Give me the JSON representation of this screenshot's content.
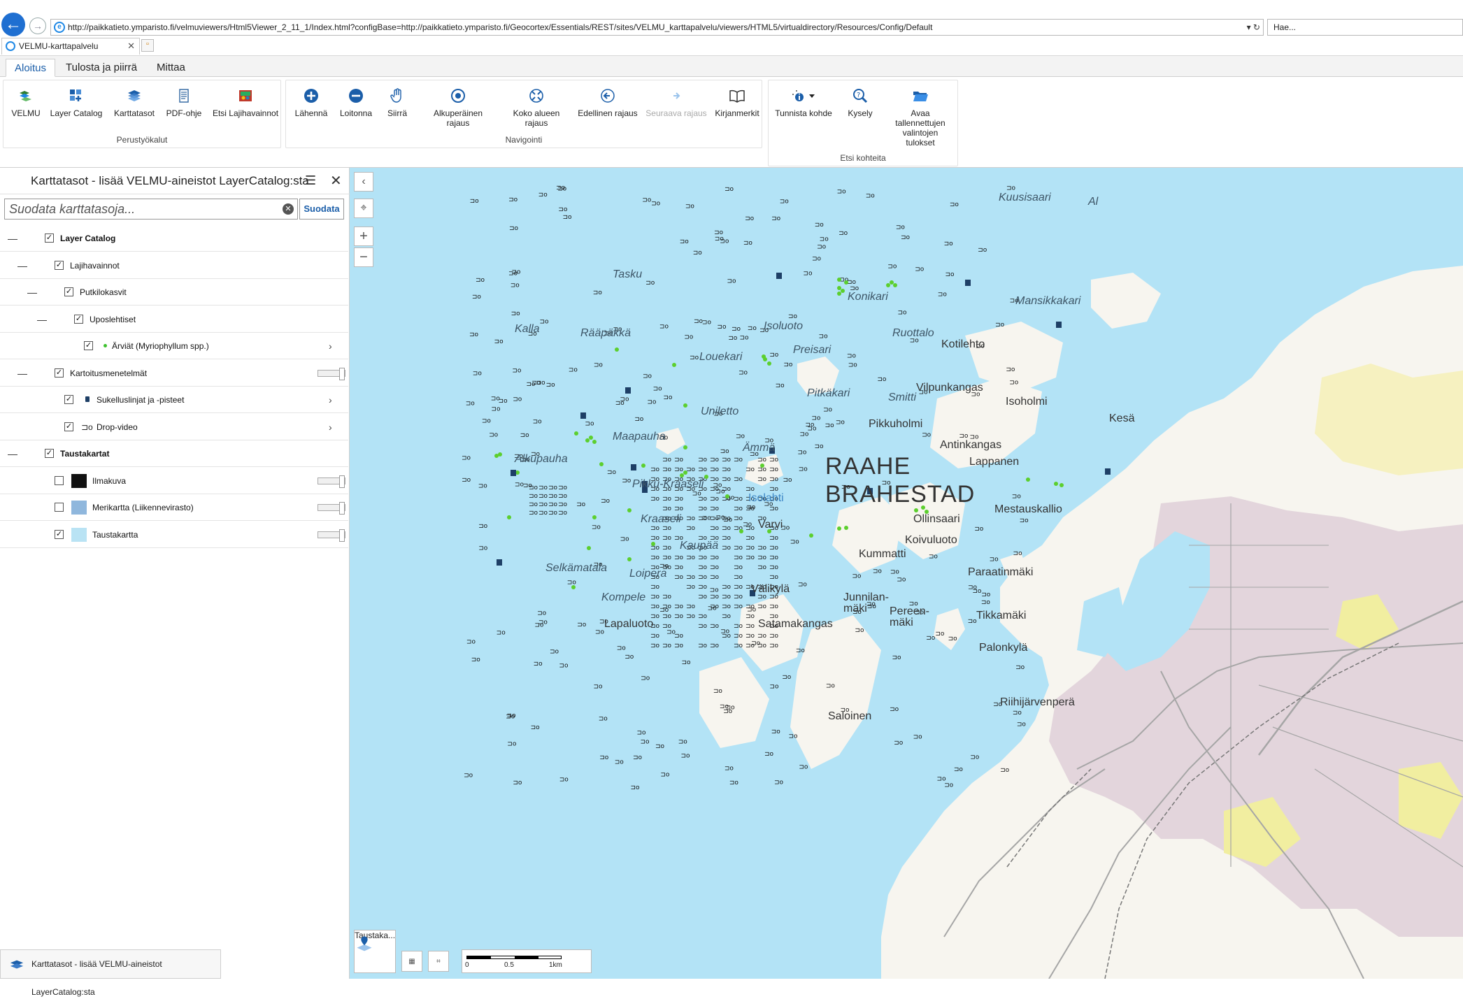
{
  "browser": {
    "url": "http://paikkatieto.ymparisto.fi/velmuviewers/Html5Viewer_2_11_1/Index.html?configBase=http://paikkatieto.ymparisto.fi/Geocortex/Essentials/REST/sites/VELMU_karttapalvelu/viewers/HTML5/virtualdirectory/Resources/Config/Default",
    "search_placeholder": "Hae...",
    "tab_title": "VELMU-karttapalvelu",
    "addr_controls": "▾ ↻"
  },
  "ribbon": {
    "tabs": [
      "Aloitus",
      "Tulosta ja piirrä",
      "Mittaa"
    ],
    "groups": [
      {
        "label": "Perustyökalut",
        "buttons": [
          "VELMU",
          "Layer Catalog",
          "Karttatasot",
          "PDF-ohje",
          "Etsi Lajihavainnot"
        ]
      },
      {
        "label": "Navigointi",
        "buttons": [
          "Lähennä",
          "Loitonna",
          "Siirrä",
          "Alkuperäinen rajaus",
          "Koko alueen rajaus",
          "Edellinen rajaus",
          "Seuraava rajaus",
          "Kirjanmerkit"
        ]
      },
      {
        "label": "Etsi kohteita",
        "buttons": [
          "Tunnista kohde",
          "Kysely",
          "Avaa tallennettujen valintojen tulokset"
        ]
      }
    ]
  },
  "panel": {
    "title": "Karttatasot - lisää VELMU-aineistot LayerCatalog:sta",
    "filter_placeholder": "Suodata karttatasoja...",
    "filter_button": "Suodata",
    "tree": [
      {
        "label": "Layer Catalog",
        "checked": true,
        "bold": true,
        "level": 0,
        "toggle": "—"
      },
      {
        "label": "Lajihavainnot",
        "checked": true,
        "bold": false,
        "level": 1,
        "toggle": "—"
      },
      {
        "label": "Putkilokasvit",
        "checked": true,
        "bold": false,
        "level": 2,
        "toggle": "—"
      },
      {
        "label": "Uposlehtiset",
        "checked": true,
        "bold": false,
        "level": 3,
        "toggle": "—"
      },
      {
        "label": "Ärviät (Myriophyllum spp.)",
        "checked": true,
        "bold": false,
        "level": 4,
        "toggle": "",
        "symbol": "green-dot",
        "arrow": true
      },
      {
        "label": "Kartoitusmenetelmät",
        "checked": true,
        "bold": false,
        "level": 1,
        "toggle": "—",
        "slider": true
      },
      {
        "label": "Sukelluslinjat ja -pisteet",
        "checked": true,
        "bold": false,
        "level": 2,
        "toggle": "",
        "symbol": "dive",
        "arrow": true
      },
      {
        "label": "Drop-video",
        "checked": true,
        "bold": false,
        "level": 2,
        "toggle": "",
        "symbol": "camera",
        "arrow": true
      },
      {
        "label": "Taustakartat",
        "checked": true,
        "bold": true,
        "level": 0,
        "toggle": "—"
      },
      {
        "label": "Ilmakuva",
        "checked": false,
        "bold": false,
        "level": 1,
        "toggle": "",
        "thumb": "#111",
        "slider": true
      },
      {
        "label": "Merikartta (Liikennevirasto)",
        "checked": false,
        "bold": false,
        "level": 1,
        "toggle": "",
        "thumb": "#8fb7dd",
        "slider": true
      },
      {
        "label": "Taustakartta",
        "checked": true,
        "bold": false,
        "level": 1,
        "toggle": "",
        "thumb": "#b9e3f4",
        "slider": true
      }
    ],
    "taskbar_label": "Karttatasot - lisää VELMU-aineistot LayerCatalog:sta"
  },
  "map": {
    "basemap_label": "Taustaka...",
    "scale_labels": [
      "0",
      "0.5",
      "1km"
    ],
    "places": [
      {
        "name": "Kuusisaari",
        "type": "water"
      },
      {
        "name": "Tasku",
        "type": "water"
      },
      {
        "name": "Konikari",
        "type": "water"
      },
      {
        "name": "Mansikkakari",
        "type": "water"
      },
      {
        "name": "Kalla",
        "type": "water"
      },
      {
        "name": "Rääpäkkä",
        "type": "water"
      },
      {
        "name": "Isoluoto",
        "type": "water"
      },
      {
        "name": "Ruottalo",
        "type": "water"
      },
      {
        "name": "Kotilehto",
        "type": "land"
      },
      {
        "name": "Louekari",
        "type": "water"
      },
      {
        "name": "Preisari",
        "type": "water"
      },
      {
        "name": "Vilpunkangas",
        "type": "land"
      },
      {
        "name": "Isoholmi",
        "type": "land"
      },
      {
        "name": "Smitti",
        "type": "water"
      },
      {
        "name": "Pitkäkari",
        "type": "water"
      },
      {
        "name": "Uniletto",
        "type": "water"
      },
      {
        "name": "Pikkuholmi",
        "type": "land"
      },
      {
        "name": "Kesä",
        "type": "land"
      },
      {
        "name": "Maapauha",
        "type": "water"
      },
      {
        "name": "Antinkangas",
        "type": "land"
      },
      {
        "name": "Ämmä",
        "type": "water"
      },
      {
        "name": "Lappanen",
        "type": "land"
      },
      {
        "name": "RAAHE",
        "type": "city"
      },
      {
        "name": "BRAHESTAD",
        "type": "city"
      },
      {
        "name": "Alkupauha",
        "type": "water"
      },
      {
        "name": "Pikku-Kraaseli",
        "type": "water"
      },
      {
        "name": "Isolahti",
        "type": "bluew"
      },
      {
        "name": "Mestauskallio",
        "type": "land"
      },
      {
        "name": "Ollinsaari",
        "type": "land"
      },
      {
        "name": "Kraaseli",
        "type": "water"
      },
      {
        "name": "Varvi",
        "type": "land"
      },
      {
        "name": "Koivuluoto",
        "type": "land"
      },
      {
        "name": "Kummatti",
        "type": "land"
      },
      {
        "name": "Kaupää",
        "type": "water"
      },
      {
        "name": "Paraatinmäki",
        "type": "land"
      },
      {
        "name": "Selkämatala",
        "type": "water"
      },
      {
        "name": "Loipera",
        "type": "water"
      },
      {
        "name": "Välikylä",
        "type": "land"
      },
      {
        "name": "Junnilan-",
        "type": "land"
      },
      {
        "name": "mäki",
        "type": "land"
      },
      {
        "name": "Pereen-",
        "type": "land"
      },
      {
        "name": "mäki",
        "type": "land"
      },
      {
        "name": "Kompele",
        "type": "water"
      },
      {
        "name": "Tikkamäki",
        "type": "land"
      },
      {
        "name": "Lapaluoto",
        "type": "land"
      },
      {
        "name": "Satamakangas",
        "type": "land"
      },
      {
        "name": "Palonkylä",
        "type": "land"
      },
      {
        "name": "Riihijärvenperä",
        "type": "land"
      },
      {
        "name": "Saloinen",
        "type": "land"
      },
      {
        "name": "Al",
        "type": "water"
      }
    ]
  },
  "colors": {
    "accent": "#1b5ea9",
    "water": "#b3e3f6",
    "land": "#f7f5ef",
    "urban": "#e3d5dc",
    "green_obs": "#5ccf2e"
  }
}
